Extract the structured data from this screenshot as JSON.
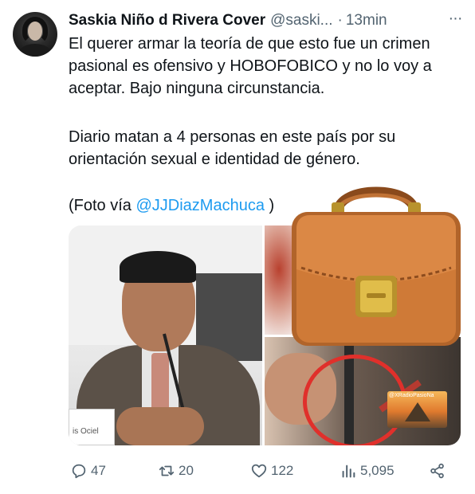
{
  "author": {
    "display_name": "Saskia Niño d Rivera Cover",
    "handle": "@saski...",
    "separator": "·",
    "time": "13min"
  },
  "more_icon": "more-horizontal-icon",
  "body": {
    "paragraph1": "El querer armar la teoría de que esto fue un crimen pasional es ofensivo y HOBOFOBICO y no lo voy a aceptar. Bajo ninguna circunstancia.",
    "paragraph2": "Diario matan a 4 personas en este país por su orientación sexual e identidad de género.",
    "photo_prefix": "(Foto vía ",
    "photo_mention": "@JJDiazMachuca",
    "photo_suffix": " )"
  },
  "media": {
    "plate_text": "is Ociel",
    "watermark": "@XRadioPasioNa"
  },
  "actions": {
    "replies": "47",
    "reposts": "20",
    "likes": "122",
    "views": "5,095"
  },
  "icons": {
    "reply": "reply-icon",
    "repost": "repost-icon",
    "like": "heart-icon",
    "views": "views-chart-icon",
    "share": "share-icon",
    "overlay": "briefcase-emoji-icon"
  },
  "colors": {
    "text": "#0f1419",
    "secondary": "#536471",
    "link": "#1d9bf0",
    "background": "#ffffff"
  }
}
